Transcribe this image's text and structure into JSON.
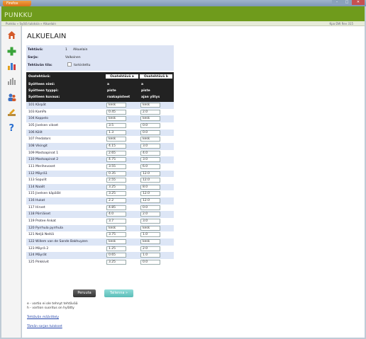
{
  "browser": {
    "menu_button": "Firefox",
    "minimize": "–",
    "maximize": "□",
    "close": "✕"
  },
  "app": {
    "name": "PUNKKU",
    "breadcrumb": "Punkku » Syötä tuloksia » Alkuelain",
    "version": "Kpa DW Rev 315"
  },
  "sidebar_icons": [
    "home-icon",
    "add-icon",
    "chart-icon",
    "stats-icon",
    "users-icon",
    "edit-icon",
    "help-icon"
  ],
  "page": {
    "title": "ALKUELAIN"
  },
  "info": {
    "task_label": "Tehtävä:",
    "task_number": "1",
    "task_name": "Alkuelain",
    "series_label": "Sarja:",
    "series_value": "Valkoinen",
    "status_label": "Tehtävän tila:",
    "status_checkbox_label": "tarkistettu"
  },
  "table": {
    "labels": {
      "subtask": "Osatehtävä:",
      "input_name": "Syötteen nimi:",
      "input_type": "Syötteen tyyppi:",
      "input_desc": "Syötteen kuvaus:"
    },
    "col_a": {
      "header": "Osatehtävä a",
      "name": "a",
      "type": "piste",
      "desc": "raakapisteet"
    },
    "col_b": {
      "header": "Osatehtävä b",
      "name": "a",
      "type": "piste",
      "desc": "ajan ylitys"
    },
    "rows": [
      {
        "name": "101 Kärpät",
        "a": "kesk",
        "b": "kesk"
      },
      {
        "name": "103 KamPa",
        "a": "0.45",
        "b": "2.0"
      },
      {
        "name": "104 Koppelo",
        "a": "kesk",
        "b": "kesk"
      },
      {
        "name": "105 Jivelsen vikset",
        "a": "3.5",
        "b": "0.0"
      },
      {
        "name": "106 Kölit",
        "a": "1.3",
        "b": "0.0"
      },
      {
        "name": "107 Predators",
        "a": "kesk",
        "b": "kesk"
      },
      {
        "name": "108 Vikingit",
        "a": "4.15",
        "b": "3.0"
      },
      {
        "name": "109 Mastoapinat 1",
        "a": "2.65",
        "b": "4.0"
      },
      {
        "name": "110 Mastoapinat 2",
        "a": "4.75",
        "b": "3.0"
      },
      {
        "name": "111 Merihevoset",
        "a": "3.55",
        "b": "6.0"
      },
      {
        "name": "112 Mäyrä1",
        "a": "0.35",
        "b": "12.0"
      },
      {
        "name": "113 Sopulit",
        "a": "2.55",
        "b": "12.0"
      },
      {
        "name": "114 Naalit",
        "a": "3.25",
        "b": "8.0"
      },
      {
        "name": "115 Jivelsen käpälät",
        "a": "3.25",
        "b": "12.0"
      },
      {
        "name": "116 Hukat",
        "a": "2.2",
        "b": "12.0"
      },
      {
        "name": "117 Hirvet",
        "a": "4.85",
        "b": "0.0"
      },
      {
        "name": "118 Pörriäiset",
        "a": "4.0",
        "b": "2.0"
      },
      {
        "name": "119 Protee Ankat",
        "a": "3.7",
        "b": "3.0"
      },
      {
        "name": "120 Pyrrhula pyrrhula",
        "a": "kesk",
        "b": "kesk"
      },
      {
        "name": "121 Neljä Neitiä",
        "a": "3.75",
        "b": "1.0"
      },
      {
        "name": "122 Willem van de Sande Bakhuyzen",
        "a": "kesk",
        "b": "kesk"
      },
      {
        "name": "123 Mäyrä 2",
        "a": "1.25",
        "b": "2.0"
      },
      {
        "name": "124 Mäyrät",
        "a": "0.65",
        "b": "1.0"
      },
      {
        "name": "125 Pinkkivit",
        "a": "3.25",
        "b": "0.0"
      }
    ]
  },
  "buttons": {
    "cancel": "Peruuta",
    "save": "Tallenna »"
  },
  "notes": {
    "e": "e - vartio ei ole tehnyt tehtävää",
    "h": "h - vartion suoritus on hylätty"
  },
  "links": {
    "task_definition": "Tehtävän määrittely",
    "series_results": "Tämän sarjan tulokset"
  }
}
